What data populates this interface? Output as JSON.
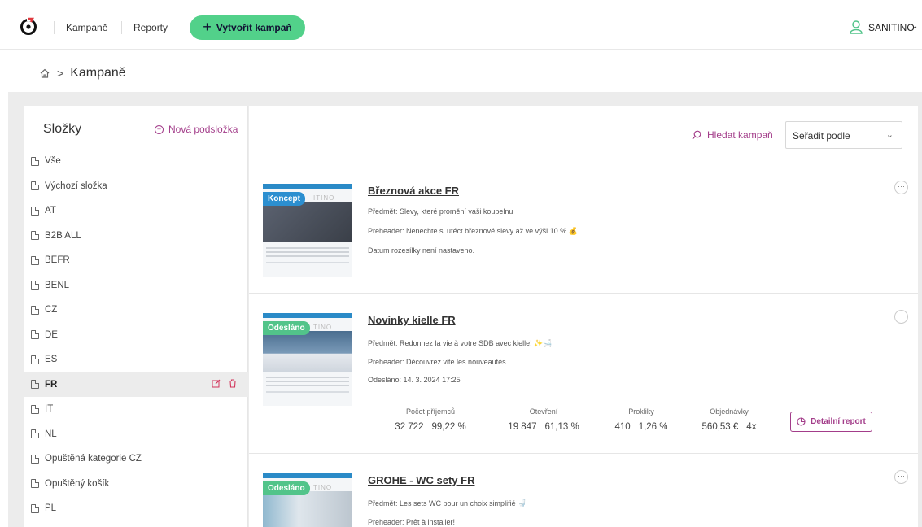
{
  "topbar": {
    "nav": [
      "Kampaně",
      "Reporty"
    ],
    "create_label": "Vytvořit kampaň",
    "user_name": "SANITINO"
  },
  "breadcrumb": {
    "current": "Kampaně"
  },
  "sidebar": {
    "title": "Složky",
    "new_subfolder": "Nová podsložka",
    "folders": [
      "Vše",
      "Výchozí složka",
      "AT",
      "B2B ALL",
      "BEFR",
      "BENL",
      "CZ",
      "DE",
      "ES",
      "FR",
      "IT",
      "NL",
      "Opuštěná kategorie CZ",
      "Opuštěný košík",
      "PL"
    ],
    "active_folder": "FR"
  },
  "toolbar": {
    "search_label": "Hledat kampaň",
    "sort_label": "Seřadit podle"
  },
  "colors": {
    "accent": "#a33d8a",
    "create_button": "#52d18a",
    "badge_concept": "#2c8fd0",
    "badge_sent": "#52c48a"
  },
  "campaigns": [
    {
      "status": "Koncept",
      "thumb_brand": "ITINO",
      "title": "Březnová akce FR",
      "subject": "Předmět: Slevy, které promění vaši koupelnu",
      "preheader": "Preheader: Nenechte si utéct březnové slevy až ve výši 10 % 💰",
      "date": "Datum rozesílky není nastaveno."
    },
    {
      "status": "Odesláno",
      "thumb_brand": "TINO",
      "title": "Novinky kielle FR",
      "subject": "Předmět: Redonnez la vie à votre SDB avec kielle! ✨🛁",
      "preheader": "Preheader: Découvrez vite les nouveautés.",
      "date": "Odesláno: 14. 3. 2024 17:25",
      "stats": [
        {
          "label": "Počet příjemců",
          "value": "32 722",
          "percent": "99,22 %"
        },
        {
          "label": "Otevření",
          "value": "19 847",
          "percent": "61,13 %"
        },
        {
          "label": "Prokliky",
          "value": "410",
          "percent": "1,26 %"
        },
        {
          "label": "Objednávky",
          "value": "560,53 €",
          "percent": "4x"
        }
      ],
      "report_label": "Detailní report"
    },
    {
      "status": "Odesláno",
      "thumb_brand": "TINO",
      "title": "GROHE - WC sety FR",
      "subject": "Předmět: Les sets WC pour un choix simplifié 🚽",
      "preheader": "Preheader: Prêt à installer!"
    }
  ]
}
